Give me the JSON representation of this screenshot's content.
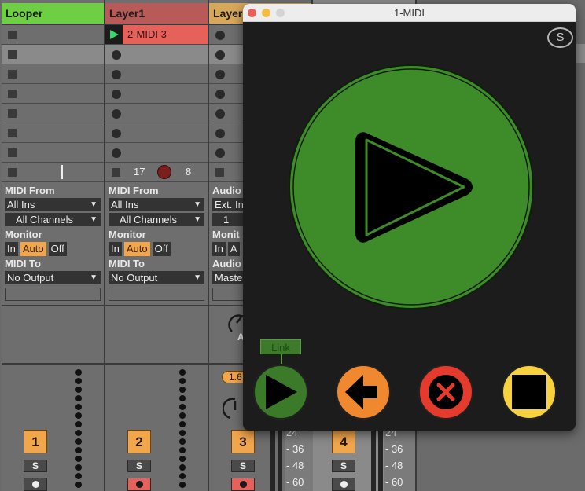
{
  "tracks": [
    {
      "name": "Looper",
      "color": "#6fcf44",
      "number": "1",
      "clip_slots": 8,
      "highlight_slot": 1,
      "slot_icon": "stop-button",
      "clip": null,
      "status_marker": "|",
      "input_label": "MIDI From",
      "input_source": "All Ins",
      "input_channel": "All Channels",
      "monitor_label": "Monitor",
      "monitor_options": [
        "In",
        "Auto",
        "Off"
      ],
      "monitor_active": "Auto",
      "output_label": "MIDI To",
      "output_target": "No Output",
      "solo": "S",
      "arm_active": false
    },
    {
      "name": "Layer1",
      "color": "#b85a57",
      "number": "2",
      "clip_slots": 8,
      "highlight_slot": 1,
      "slot_icon": "record-button",
      "clip": {
        "name": "2-MIDI 3",
        "playing": true
      },
      "status_left": "17",
      "status_right": "8",
      "input_label": "MIDI From",
      "input_source": "All Ins",
      "input_channel": "All Channels",
      "monitor_label": "Monitor",
      "monitor_options": [
        "In",
        "Auto",
        "Off"
      ],
      "monitor_active": "Auto",
      "output_label": "MIDI To",
      "output_target": "No Output",
      "solo": "S",
      "arm_active": true
    },
    {
      "name": "Layer",
      "color": "#d7a85a",
      "number": "3",
      "clip_slots": 8,
      "highlight_slot": 1,
      "slot_icon": "record-button",
      "input_label": "Audio",
      "input_source": "Ext. In",
      "input_channel": "1",
      "monitor_label": "Monit",
      "monitor_options": [
        "In",
        "A"
      ],
      "monitor_active": "",
      "output_label": "Audio",
      "output_target": "Maste",
      "send_label": "A",
      "pan_value": "1.6",
      "solo": "S",
      "arm_active": true
    },
    {
      "name": "",
      "number": "4",
      "solo": "S",
      "arm_active": false
    }
  ],
  "meter_scale": [
    "24",
    "36",
    "48",
    "60"
  ],
  "plugin_window": {
    "title": "1-MIDI",
    "s_button": "S",
    "link_label": "Link",
    "colors": {
      "green": "#3e8b2a",
      "orange": "#f0882f",
      "red": "#e53b2c",
      "yellow": "#f7d23d"
    },
    "buttons": [
      "play",
      "back",
      "clear",
      "stop"
    ]
  }
}
